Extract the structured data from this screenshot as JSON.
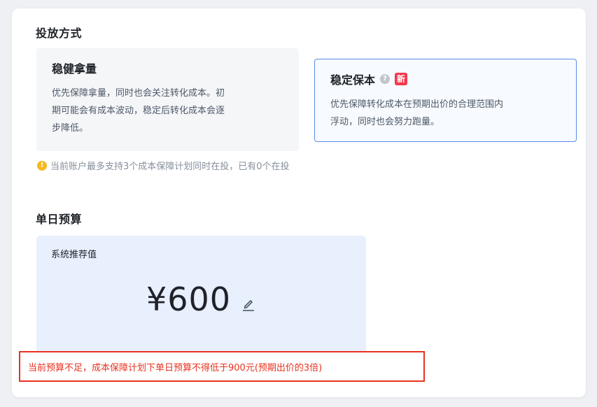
{
  "delivery": {
    "title": "投放方式",
    "options": [
      {
        "title": "稳健拿量",
        "desc_lines": [
          "优先保障拿量，同时也会关注转化成本。初",
          "期可能会有成本波动，稳定后转化成本会逐",
          "步降低。"
        ],
        "selected": false
      },
      {
        "title": "稳定保本",
        "help_glyph": "?",
        "badge": "新",
        "desc_lines": [
          "优先保障转化成本在预期出价的合理范围内",
          "浮动，同时也会努力跑量。"
        ],
        "selected": true
      }
    ],
    "note": "当前账户最多支持3个成本保障计划同时在投，已有0个在投",
    "note_icon": "!"
  },
  "budget": {
    "title": "单日预算",
    "recommend_label": "系统推荐值",
    "amount": "¥600",
    "edit_icon": "pencil-icon"
  },
  "error": {
    "text": "当前预算不足，成本保障计划下单日预算不得低于900元(预期出价的3倍)"
  },
  "colors": {
    "accent": "#5a8de8",
    "error": "#e8321f",
    "badge": "#f0384c",
    "warn": "#f7ba1e",
    "budget_bg": "#e8effd"
  }
}
